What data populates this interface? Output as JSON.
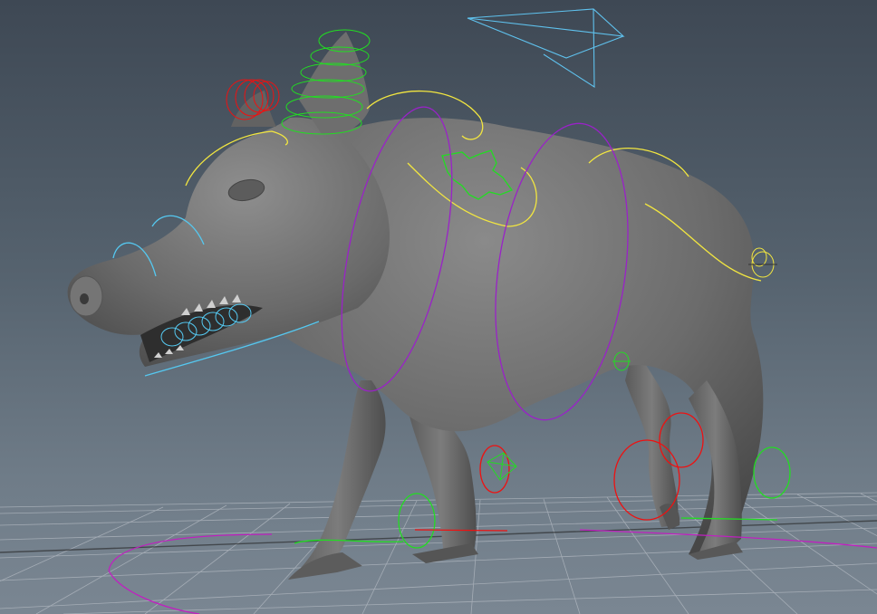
{
  "app": "3D viewport",
  "scene": {
    "subject": "boar-model",
    "shading": "smooth-gray",
    "grid": true
  },
  "colors": {
    "background_top": "#3e4854",
    "background_bottom": "#7a8692",
    "model": "#6b6b6b",
    "grid": "#b8bec6",
    "ctrl_yellow": "#f2e640",
    "ctrl_green": "#22dd22",
    "ctrl_red": "#ee1111",
    "ctrl_purple": "#9a22c8",
    "ctrl_magenta": "#c020c0",
    "ctrl_cyan": "#55c8f0",
    "camera_icon": "#5fc2ee"
  }
}
